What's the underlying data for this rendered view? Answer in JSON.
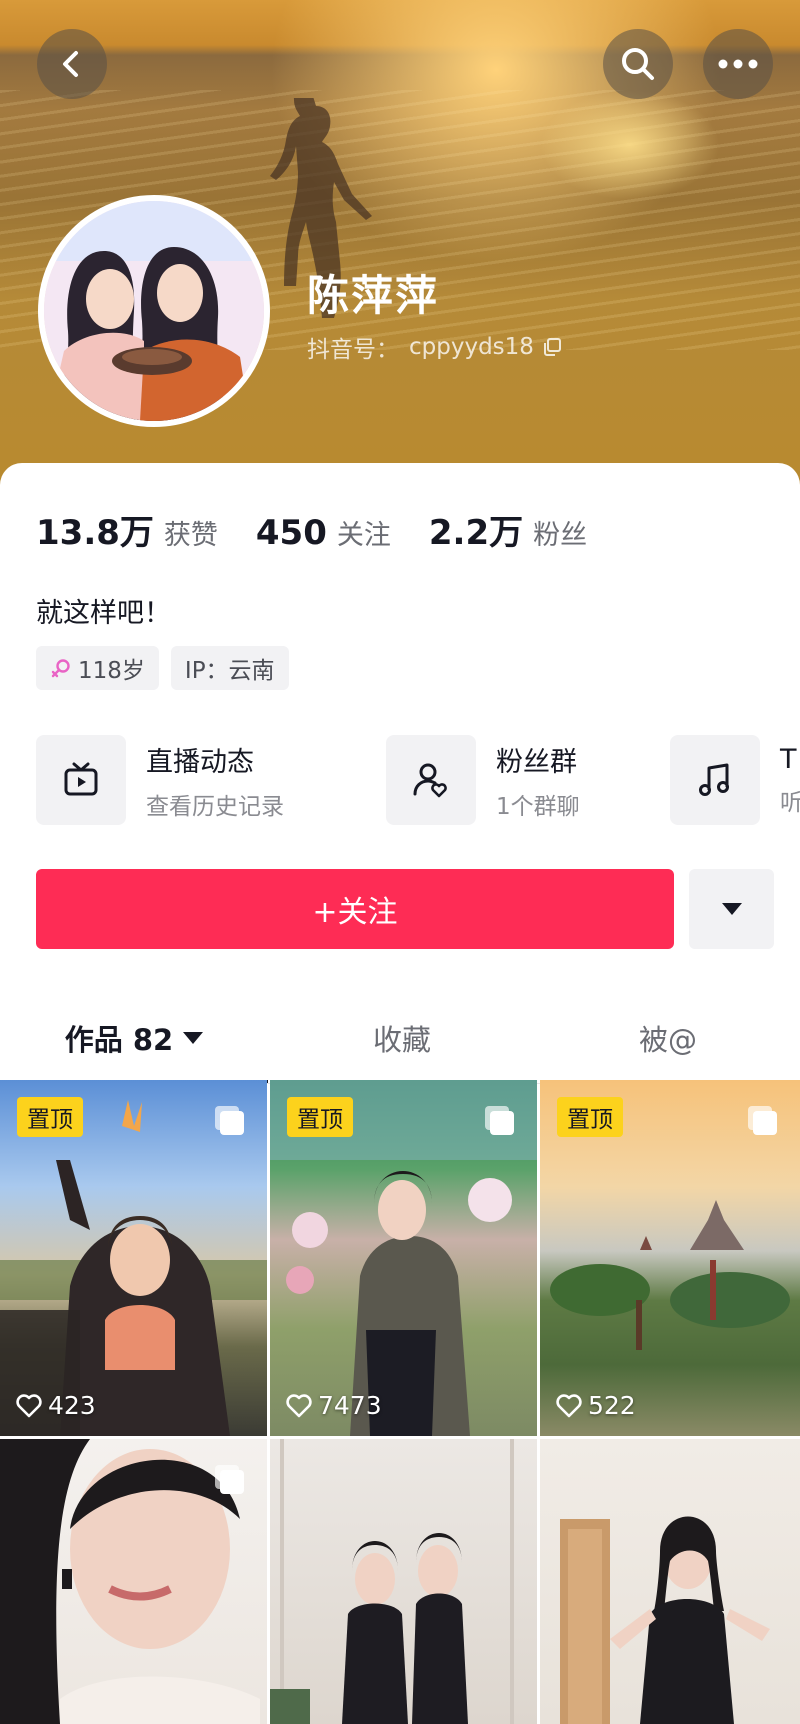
{
  "profile": {
    "name": "陈萍萍",
    "douyin_id_label": "抖音号：",
    "douyin_id": "cppyyds18",
    "bio": "就这样吧！"
  },
  "stats": [
    {
      "value": "13.8万",
      "label": "获赞"
    },
    {
      "value": "450",
      "label": "关注"
    },
    {
      "value": "2.2万",
      "label": "粉丝"
    }
  ],
  "tags": {
    "age": "118岁",
    "ip": "IP：云南"
  },
  "features": [
    {
      "title": "直播动态",
      "subtitle": "查看历史记录",
      "icon": "tv-icon"
    },
    {
      "title": "粉丝群",
      "subtitle": "1个群聊",
      "icon": "fan-group-icon"
    },
    {
      "title": "T",
      "subtitle": "听",
      "icon": "music-note-icon"
    }
  ],
  "actions": {
    "follow_label": "+关注"
  },
  "tabs": {
    "works_label": "作品 82",
    "favorites_label": "收藏",
    "mentions_label": "被@"
  },
  "grid": {
    "pin_label": "置顶",
    "videos": [
      {
        "likes": "423",
        "pinned": true
      },
      {
        "likes": "7473",
        "pinned": true
      },
      {
        "likes": "522",
        "pinned": true
      },
      {
        "likes": "",
        "pinned": false
      },
      {
        "likes": "",
        "pinned": false
      },
      {
        "likes": "",
        "pinned": false
      }
    ]
  },
  "colors": {
    "follow_button": "#fe2c55",
    "pin_badge": "#fcd21c",
    "text_primary": "#161823"
  }
}
